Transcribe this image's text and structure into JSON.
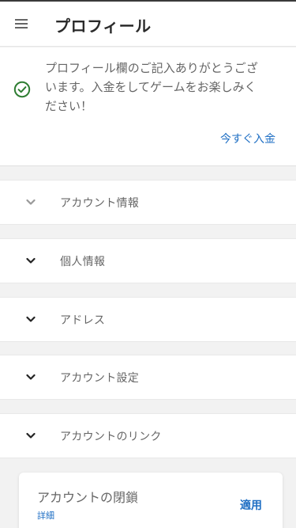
{
  "header": {
    "title": "プロフィール",
    "menu_icon": "hamburger-menu-icon"
  },
  "notice": {
    "icon": "check-circle-icon",
    "icon_color": "#2e7d32",
    "line1": "プロフィール欄のご記入ありがとうござ",
    "line2": "います。入金をしてゲームをお楽しみく",
    "line3": "ださい！",
    "deposit_label": "今すぐ入金"
  },
  "sections": [
    {
      "label": "アカウント情報",
      "icon": "chevron-down-icon"
    },
    {
      "label": "個人情報",
      "icon": "chevron-down-icon"
    },
    {
      "label": "アドレス",
      "icon": "chevron-down-icon"
    },
    {
      "label": "アカウント設定",
      "icon": "chevron-down-icon"
    },
    {
      "label": "アカウントのリンク",
      "icon": "chevron-down-icon"
    }
  ],
  "account_close": {
    "title": "アカウントの閉鎖",
    "details_label": "詳細",
    "apply_label": "適用"
  },
  "colors": {
    "accent": "#1f6fc4",
    "success": "#2e7d32",
    "background": "#f2f2f2"
  }
}
